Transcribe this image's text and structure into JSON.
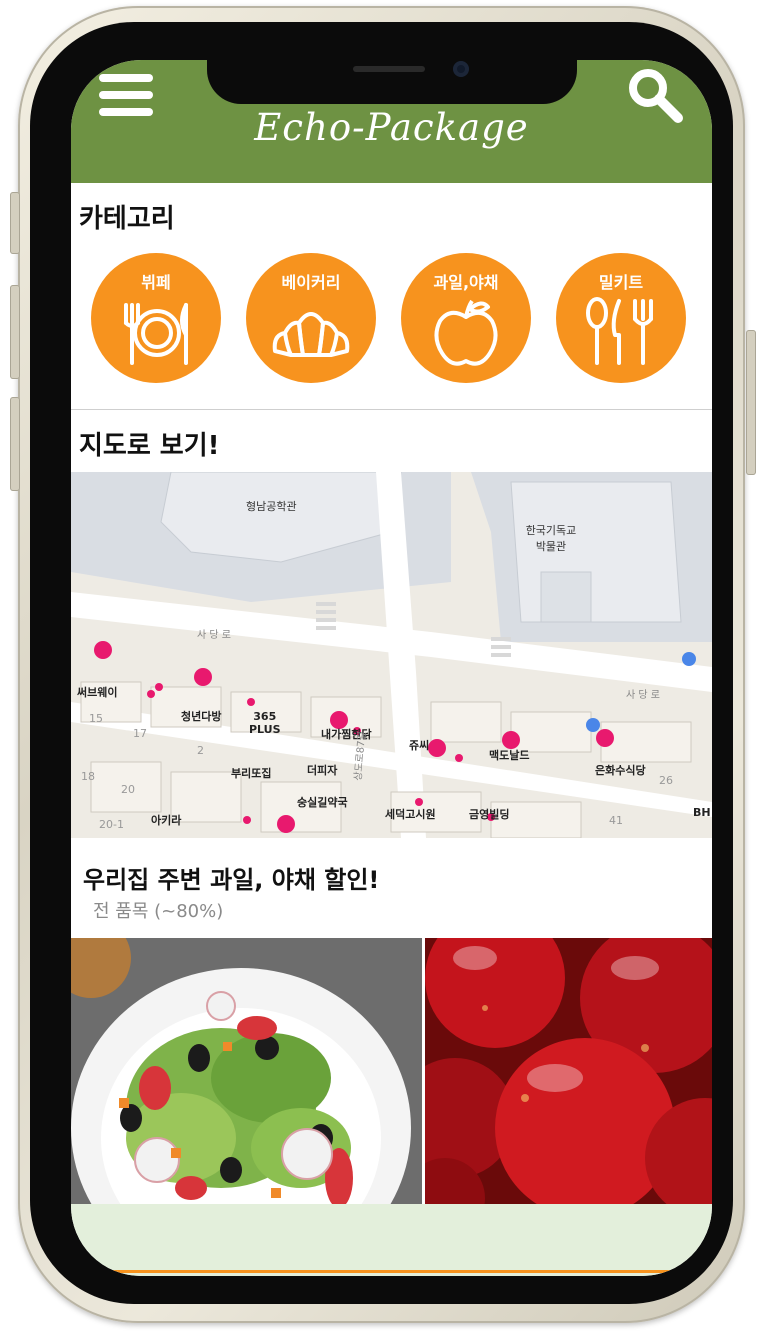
{
  "app": {
    "title": "Echo-Package"
  },
  "header": {
    "menu_icon": "hamburger-menu-icon",
    "search_icon": "search-icon",
    "color": "#6e9243"
  },
  "category": {
    "title": "카테고리",
    "items": [
      {
        "label": "뷔페",
        "icon": "plate-fork-knife-icon"
      },
      {
        "label": "베이커리",
        "icon": "croissant-icon"
      },
      {
        "label": "과일,야채",
        "icon": "apple-icon"
      },
      {
        "label": "밀키트",
        "icon": "spoon-knife-fork-icon"
      }
    ],
    "accent": "#f7931e"
  },
  "map": {
    "title": "지도로 보기!",
    "labels": {
      "hall": "형남공학관",
      "museum": "한국기독교\n박물관",
      "road1": "사 당 로",
      "road2": "사 당 로",
      "subway": "써브웨이",
      "cafe": "청년다방",
      "store": "365\nPLUS",
      "chicken": "내가찜한닭",
      "juice": "쥬씨",
      "mcd": "맥도날드",
      "cafeteria": "은화수식당",
      "bbq": "부리또집",
      "pizza": "더피자",
      "soup": "숭실길약국",
      "akira": "아키라",
      "goshiwon": "세덕고시원",
      "building": "금영빌딩",
      "bh": "BH",
      "n15": "15",
      "n17": "17",
      "n2": "2",
      "n18": "18",
      "n20": "20",
      "n20_1": "20-1",
      "n26": "26",
      "n41": "41",
      "road_name": "상도로87길"
    }
  },
  "promo": {
    "title": "우리집 주변 과일, 야채 할인!",
    "subtitle": "전 품목 (~80%)",
    "images": [
      {
        "name": "salad-image"
      },
      {
        "name": "apples-image"
      }
    ]
  }
}
